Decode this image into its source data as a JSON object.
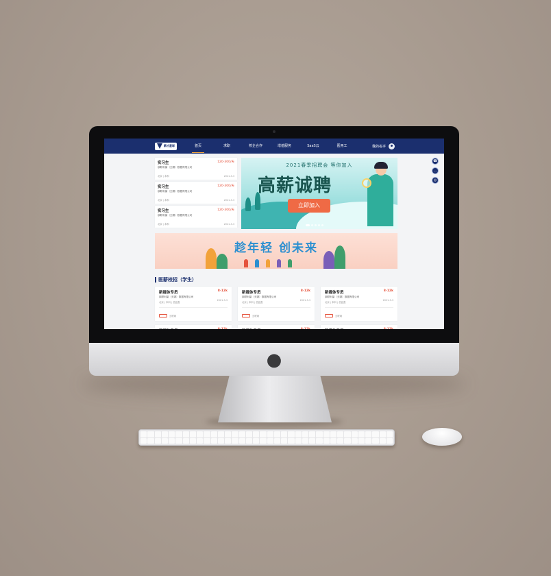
{
  "nav": {
    "logo_text": "薪才星球",
    "items": [
      "首页",
      "求职",
      "校企合作",
      "增值服务",
      "SaaS云",
      "医用工"
    ],
    "active_index": 0,
    "user_name": "我的名字"
  },
  "side_tools": [
    "phone-icon",
    "chat-icon",
    "service-icon"
  ],
  "jobs": [
    {
      "title": "实习生",
      "salary": "120-300/天",
      "company": "钢联利豪（无锡）数据有限公司",
      "meta": "北京 | 本科",
      "date": "2021-3-3"
    },
    {
      "title": "实习生",
      "salary": "120-300/天",
      "company": "钢联利豪（无锡）数据有限公司",
      "meta": "北京 | 本科",
      "date": "2021-3-3"
    },
    {
      "title": "实习生",
      "salary": "120-300/天",
      "company": "钢联利豪（无锡）数据有限公司",
      "meta": "北京 | 本科",
      "date": "2021-3-3"
    }
  ],
  "banner": {
    "subtitle": "2021春季招聘会 等你加入",
    "title": "高薪诚聘",
    "button": "立即加入",
    "slide_count": 5,
    "active_slide": 0
  },
  "promo": {
    "title": "趁年轻 创未来"
  },
  "section_title": "医薪校招（学生）",
  "campus_jobs": [
    {
      "title": "新媒体专员",
      "salary": "8-12k",
      "company": "钢联利豪（无锡）数据有限公司",
      "meta": "北京 | 本科 | 总监直",
      "date": "2021-3-3",
      "tag": "互联网"
    },
    {
      "title": "新媒体专员",
      "salary": "8-12k",
      "company": "钢联利豪（无锡）数据有限公司",
      "meta": "北京 | 本科 | 总监直",
      "date": "2021-3-3",
      "tag": "互联网"
    },
    {
      "title": "新媒体专员",
      "salary": "8-12k",
      "company": "钢联利豪（无锡）数据有限公司",
      "meta": "北京 | 本科 | 总监直",
      "date": "2021-3-3",
      "tag": "互联网"
    }
  ],
  "colors": {
    "nav_bg": "#1b2f6e",
    "accent": "#f2a23a",
    "salary": "#e5533d",
    "banner_btn": "#ef6a45",
    "promo_title": "#2c8fd0"
  }
}
